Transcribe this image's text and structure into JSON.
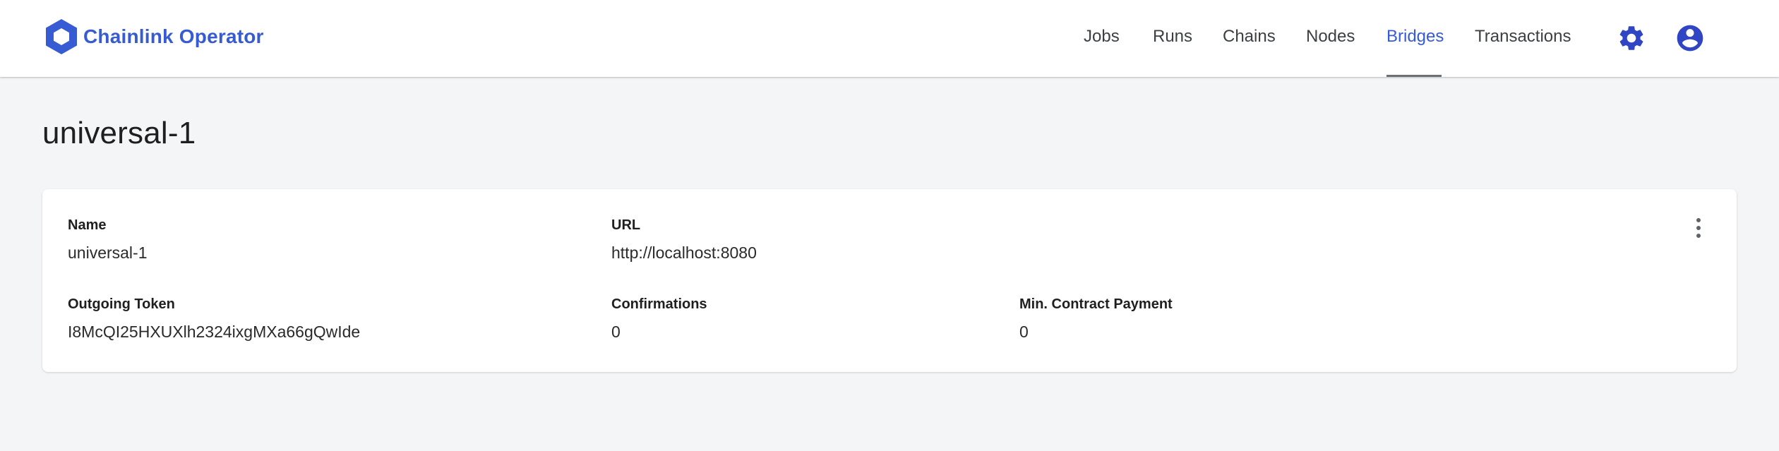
{
  "brand": {
    "name": "Chainlink Operator",
    "color": "#375bd2"
  },
  "nav": {
    "items": [
      {
        "label": "Jobs",
        "active": false
      },
      {
        "label": "Runs",
        "active": false
      },
      {
        "label": "Chains",
        "active": false
      },
      {
        "label": "Nodes",
        "active": false
      },
      {
        "label": "Bridges",
        "active": true
      },
      {
        "label": "Transactions",
        "active": false
      }
    ],
    "icons": [
      "gear-icon",
      "account-circle-icon"
    ]
  },
  "page": {
    "title": "universal-1"
  },
  "bridge": {
    "name_label": "Name",
    "name_value": "universal-1",
    "url_label": "URL",
    "url_value": "http://localhost:8080",
    "token_label": "Outgoing Token",
    "token_value": "I8McQI25HXUXlh2324ixgMXa66gQwIde",
    "confirmations_label": "Confirmations",
    "confirmations_value": "0",
    "min_payment_label": "Min. Contract Payment",
    "min_payment_value": "0",
    "menu_icon": "more-vertical-icon"
  }
}
